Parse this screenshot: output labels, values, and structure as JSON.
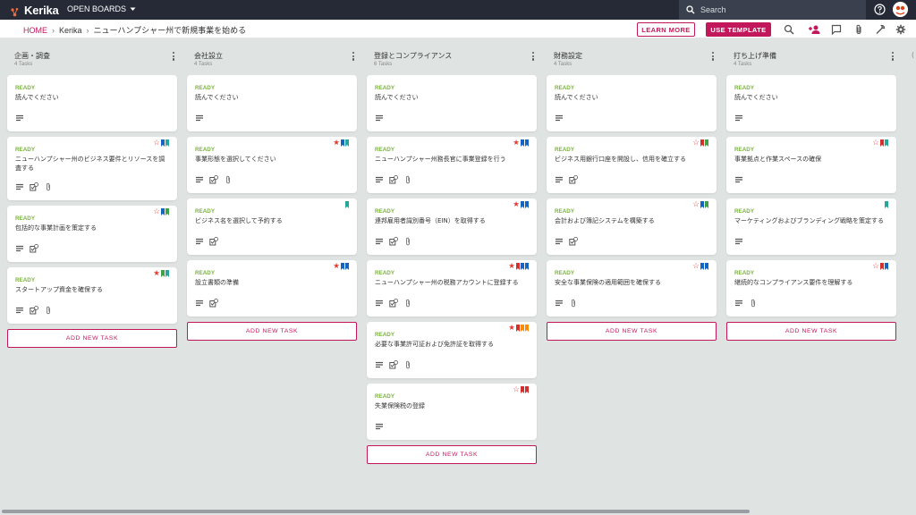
{
  "app": {
    "logo_text": "Kerika",
    "open_boards_label": "OPEN BOARDS"
  },
  "search": {
    "placeholder": "Search"
  },
  "breadcrumb": {
    "home": "HOME",
    "org": "Kerika",
    "board": "ニューハンプシャー州で新規事業を始める"
  },
  "actions": {
    "learn_more": "LEARN MORE",
    "use_template": "USE TEMPLATE"
  },
  "toolbar_icons": [
    "search-icon",
    "add-person-icon",
    "chat-icon",
    "attachment-icon",
    "wrench-icon",
    "gear-icon"
  ],
  "colors": {
    "accent": "#c2185b",
    "ready": "#7cb342",
    "topbar": "#252a36",
    "flag_blue": "#1565c0",
    "flag_green": "#43a047",
    "flag_teal": "#26a69a",
    "flag_red": "#d32f2f",
    "flag_orange": "#fb8c00"
  },
  "add_task_label": "ADD NEW TASK",
  "columns": [
    {
      "title": "企画・調査",
      "count": "4 Tasks",
      "cards": [
        {
          "status": "READY",
          "title": "読んでください",
          "star": null,
          "flags": [],
          "icons": [
            "description"
          ]
        },
        {
          "status": "READY",
          "title": "ニューハンプシャー州のビジネス要件とリソースを調査する",
          "star": "off",
          "flags": [
            "blue",
            "teal"
          ],
          "icons": [
            "description",
            "checklist",
            "attachment"
          ]
        },
        {
          "status": "READY",
          "title": "包括的な事業計画を策定する",
          "star": "off",
          "flags": [
            "blue",
            "green"
          ],
          "icons": [
            "description",
            "checklist"
          ]
        },
        {
          "status": "READY",
          "title": "スタートアップ資金を確保する",
          "star": "on",
          "flags": [
            "green",
            "teal"
          ],
          "icons": [
            "description",
            "checklist",
            "attachment"
          ]
        }
      ]
    },
    {
      "title": "会社設立",
      "count": "4 Tasks",
      "cards": [
        {
          "status": "READY",
          "title": "読んでください",
          "star": null,
          "flags": [],
          "icons": [
            "description"
          ]
        },
        {
          "status": "READY",
          "title": "事業形態を選択してください",
          "star": "on",
          "flags": [
            "blue",
            "teal"
          ],
          "icons": [
            "description",
            "checklist",
            "attachment"
          ]
        },
        {
          "status": "READY",
          "title": "ビジネス名を選択して予約する",
          "star": null,
          "flags": [
            "teal"
          ],
          "icons": [
            "description",
            "checklist"
          ]
        },
        {
          "status": "READY",
          "title": "設立書類の準備",
          "star": "on",
          "flags": [
            "blue",
            "blue"
          ],
          "icons": [
            "description",
            "checklist"
          ]
        }
      ]
    },
    {
      "title": "登録とコンプライアンス",
      "count": "6 Tasks",
      "cards": [
        {
          "status": "READY",
          "title": "読んでください",
          "star": null,
          "flags": [],
          "icons": [
            "description"
          ]
        },
        {
          "status": "READY",
          "title": "ニューハンプシャー州務長官に事業登録を行う",
          "star": "on",
          "flags": [
            "blue",
            "blue"
          ],
          "icons": [
            "description",
            "checklist",
            "attachment"
          ]
        },
        {
          "status": "READY",
          "title": "連邦雇用者識別番号（EIN）を取得する",
          "star": "on",
          "flags": [
            "blue",
            "blue"
          ],
          "icons": [
            "description",
            "checklist",
            "attachment"
          ]
        },
        {
          "status": "READY",
          "title": "ニューハンプシャー州の税務アカウントに登録する",
          "star": "on",
          "flags": [
            "red",
            "blue",
            "blue"
          ],
          "icons": [
            "description",
            "checklist",
            "attachment"
          ]
        },
        {
          "status": "READY",
          "title": "必要な事業許可証および免許証を取得する",
          "star": "on",
          "flags": [
            "red",
            "orange",
            "orange"
          ],
          "icons": [
            "description",
            "checklist",
            "attachment"
          ]
        },
        {
          "status": "READY",
          "title": "失業保険税の登録",
          "star": "off",
          "flags": [
            "red",
            "red"
          ],
          "icons": [
            "description"
          ]
        }
      ]
    },
    {
      "title": "財務設定",
      "count": "4 Tasks",
      "cards": [
        {
          "status": "READY",
          "title": "読んでください",
          "star": null,
          "flags": [],
          "icons": [
            "description"
          ]
        },
        {
          "status": "READY",
          "title": "ビジネス用銀行口座を開設し、信用を確立する",
          "star": "off",
          "flags": [
            "red",
            "green"
          ],
          "icons": [
            "description",
            "checklist"
          ]
        },
        {
          "status": "READY",
          "title": "会計および簿記システムを構築する",
          "star": "off",
          "flags": [
            "blue",
            "green"
          ],
          "icons": [
            "description",
            "checklist"
          ]
        },
        {
          "status": "READY",
          "title": "安全な事業保険の適用範囲を確保する",
          "star": "off",
          "flags": [
            "blue",
            "blue"
          ],
          "icons": [
            "description",
            "attachment"
          ]
        }
      ]
    },
    {
      "title": "打ち上げ準備",
      "count": "4 Tasks",
      "cards": [
        {
          "status": "READY",
          "title": "読んでください",
          "star": null,
          "flags": [],
          "icons": [
            "description"
          ]
        },
        {
          "status": "READY",
          "title": "事業拠点と作業スペースの確保",
          "star": "off",
          "flags": [
            "red",
            "teal"
          ],
          "icons": [
            "description"
          ]
        },
        {
          "status": "READY",
          "title": "マーケティングおよびブランディング戦略を策定する",
          "star": null,
          "flags": [
            "teal"
          ],
          "icons": [
            "description"
          ]
        },
        {
          "status": "READY",
          "title": "継続的なコンプライアンス要件を理解する",
          "star": "off",
          "flags": [
            "red",
            "blue"
          ],
          "icons": [
            "description",
            "attachment"
          ]
        }
      ]
    }
  ]
}
